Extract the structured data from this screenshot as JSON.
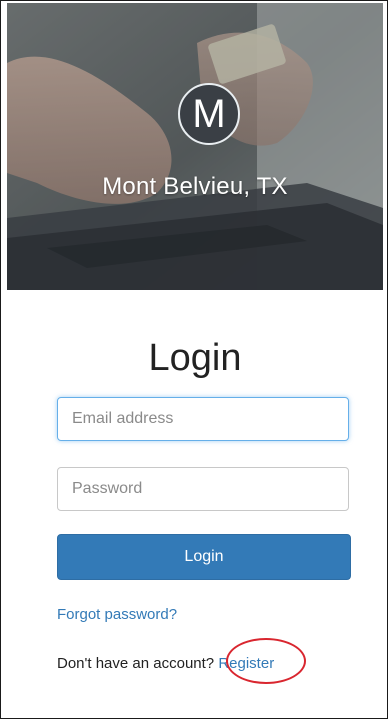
{
  "hero": {
    "logo_letter": "M",
    "city": "Mont Belvieu, TX"
  },
  "form": {
    "title": "Login",
    "email": {
      "placeholder": "Email address",
      "value": ""
    },
    "password": {
      "placeholder": "Password",
      "value": ""
    },
    "login_button": "Login",
    "forgot_password": "Forgot password?",
    "no_account_text": "Don't have an account?",
    "register_link": "Register"
  },
  "colors": {
    "primary": "#337ab7",
    "annotation": "#d9262f"
  }
}
